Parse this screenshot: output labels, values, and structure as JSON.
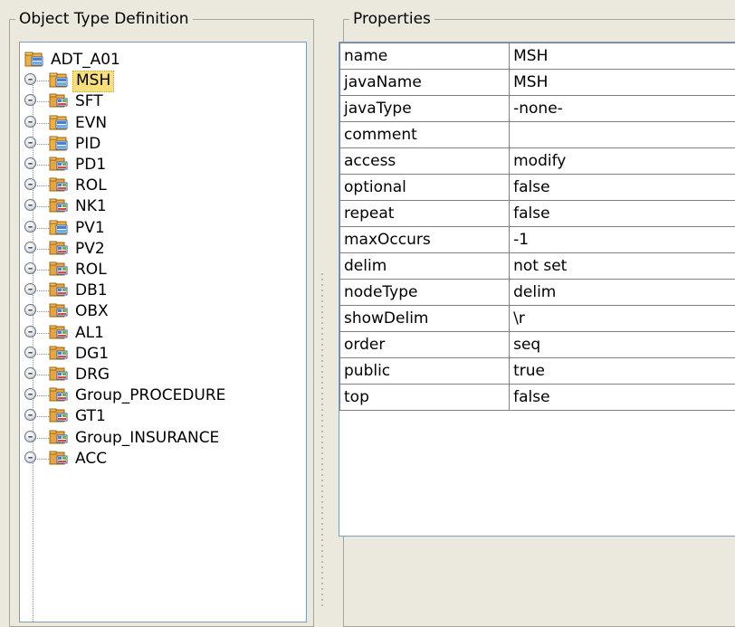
{
  "object_type_panel": {
    "title": "Object Type Definition",
    "root": {
      "label": "ADT_A01",
      "icon": "segment-icon"
    },
    "selected": "MSH",
    "nodes": [
      {
        "label": "MSH",
        "icon": "segment-icon"
      },
      {
        "label": "SFT",
        "icon": "group-icon"
      },
      {
        "label": "EVN",
        "icon": "segment-icon"
      },
      {
        "label": "PID",
        "icon": "segment-icon"
      },
      {
        "label": "PD1",
        "icon": "group-icon"
      },
      {
        "label": "ROL",
        "icon": "group-icon"
      },
      {
        "label": "NK1",
        "icon": "group-icon"
      },
      {
        "label": "PV1",
        "icon": "segment-icon"
      },
      {
        "label": "PV2",
        "icon": "group-icon"
      },
      {
        "label": "ROL",
        "icon": "group-icon"
      },
      {
        "label": "DB1",
        "icon": "group-icon"
      },
      {
        "label": "OBX",
        "icon": "group-icon"
      },
      {
        "label": "AL1",
        "icon": "group-icon"
      },
      {
        "label": "DG1",
        "icon": "group-icon"
      },
      {
        "label": "DRG",
        "icon": "group-icon"
      },
      {
        "label": "Group_PROCEDURE",
        "icon": "group-icon"
      },
      {
        "label": "GT1",
        "icon": "group-icon"
      },
      {
        "label": "Group_INSURANCE",
        "icon": "group-icon"
      },
      {
        "label": "ACC",
        "icon": "group-icon"
      }
    ]
  },
  "properties_panel": {
    "title": "Properties",
    "rows": [
      {
        "name": "name",
        "value": "MSH"
      },
      {
        "name": "javaName",
        "value": "MSH"
      },
      {
        "name": "javaType",
        "value": "-none-"
      },
      {
        "name": "comment",
        "value": ""
      },
      {
        "name": "access",
        "value": "modify"
      },
      {
        "name": "optional",
        "value": "false"
      },
      {
        "name": "repeat",
        "value": "false"
      },
      {
        "name": "maxOccurs",
        "value": "-1"
      },
      {
        "name": "delim",
        "value": "not set"
      },
      {
        "name": "nodeType",
        "value": "delim"
      },
      {
        "name": "showDelim",
        "value": "\\r"
      },
      {
        "name": "order",
        "value": "seq"
      },
      {
        "name": "public",
        "value": "true"
      },
      {
        "name": "top",
        "value": "false"
      }
    ]
  },
  "colors": {
    "background": "#ebe9dd",
    "selection": "#f8df7e",
    "panel_border": "#7f9db9",
    "grid_line": "#808080"
  }
}
